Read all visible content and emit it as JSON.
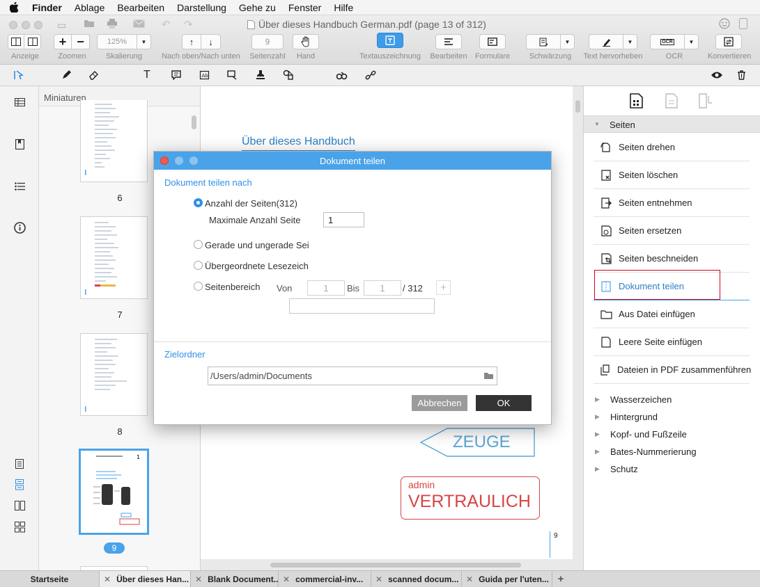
{
  "menubar": {
    "items": [
      "Finder",
      "Ablage",
      "Bearbeiten",
      "Darstellung",
      "Gehe zu",
      "Fenster",
      "Hilfe"
    ]
  },
  "window": {
    "title": "Über dieses Handbuch  German.pdf (page 13 of 312)"
  },
  "toolbar": {
    "labels": {
      "view": "Anzeige",
      "zoom": "Zoomen",
      "scale": "Skalierung",
      "nav": "Nach oben/Nach unten",
      "page_count": "Seitenzahl",
      "hand": "Hand",
      "text_markup": "Textauszeichnung",
      "edit": "Bearbeiten",
      "forms": "Formulare",
      "redact": "Schwärzung",
      "highlight": "Text hervorheben",
      "ocr": "OCR",
      "convert": "Konvertieren"
    },
    "zoom_value": "125%",
    "page_value": "9"
  },
  "thumbnails": {
    "header": "Miniaturen",
    "pages": [
      "6",
      "7",
      "8",
      "9"
    ]
  },
  "document": {
    "heading": "Über dieses Handbuch",
    "stamp_witness": "ZEUGE",
    "stamp_user": "admin",
    "stamp_confidential": "VERTRAULICH",
    "page_num": "9"
  },
  "right_panel": {
    "section": "Seiten",
    "items": [
      "Seiten drehen",
      "Seiten löschen",
      "Seiten entnehmen",
      "Seiten ersetzen",
      "Seiten beschneiden",
      "Dokument teilen",
      "Aus Datei einfügen",
      "Leere Seite einfügen",
      "Dateien in PDF zusammenführen"
    ],
    "sections": [
      "Wasserzeichen",
      "Hintergrund",
      "Kopf- und Fußzeile",
      "Bates-Nummerierung",
      "Schutz"
    ]
  },
  "dialog": {
    "title": "Dokument teilen",
    "split_by": "Dokument teilen nach",
    "opt_pages": "Anzahl der Seiten(312)",
    "max_pages_label": "Maximale Anzahl Seite",
    "max_pages_value": "1",
    "opt_even_odd": "Gerade und ungerade Sei",
    "opt_bookmarks": "Übergeordnete Lesezeich",
    "opt_range": "Seitenbereich",
    "from_label": "Von",
    "from_value": "1",
    "to_label": "Bis",
    "to_value": "1",
    "total": "/ 312",
    "target_label": "Zielordner",
    "target_path": "/Users/admin/Documents",
    "cancel": "Abbrechen",
    "ok": "OK"
  },
  "tabs": [
    "Startseite",
    "Über dieses Han...",
    "Blank Document...",
    "commercial-inv...",
    "scanned docum...",
    "Guida per l'uten..."
  ],
  "colors": {
    "accent": "#4aa3e8",
    "highlight_border": "#d0021b",
    "stamp_blue": "#5aa7d6",
    "stamp_red": "#d64545"
  }
}
